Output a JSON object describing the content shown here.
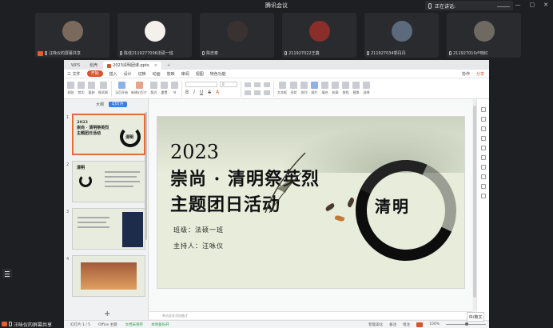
{
  "meeting": {
    "title": "腾讯会议",
    "speaking_label": "正在讲话:",
    "window_controls": [
      "—",
      "▢",
      "✕"
    ],
    "participants": [
      {
        "name": "汪咏仪的屏幕共享",
        "avatar_color": "#7a6a5e",
        "sharing": true
      },
      {
        "name": "陈佳2119277006法硕一班",
        "avatar_color": "#f4f0ec",
        "sharing": false
      },
      {
        "name": "陈忠泰",
        "avatar_color": "#3a3230",
        "sharing": false
      },
      {
        "name": "211927022王鑫",
        "avatar_color": "#8a2e2a",
        "sharing": false
      },
      {
        "name": "211927034郭丹丹",
        "avatar_color": "#5b6a7c",
        "sharing": false
      },
      {
        "name": "211927010卢琬红",
        "avatar_color": "#6e6a62",
        "sharing": false
      }
    ],
    "bottom_share_label": "汪咏仪的屏幕共享",
    "ime_label": "中/英文"
  },
  "wps": {
    "tabs": [
      {
        "label": "WPS",
        "active": false
      },
      {
        "label": "稻壳",
        "active": false
      },
      {
        "label": "2023清明团课.pptx",
        "active": true
      }
    ],
    "tab_add": "+",
    "menu": {
      "file": "三 文件",
      "items": [
        "开始",
        "插入",
        "设计",
        "切换",
        "动画",
        "放映",
        "审阅",
        "视图",
        "特色功能"
      ],
      "active_index": 0,
      "right": [
        "协作",
        "分享"
      ]
    },
    "ribbon": {
      "buttons": [
        "粘贴",
        "剪切",
        "复制",
        "格式刷",
        "当页开始",
        "新建幻灯片",
        "版式",
        "重置",
        "节"
      ],
      "font_field": "",
      "size_field": "0",
      "right_buttons": [
        "文本框",
        "形状",
        "排列",
        "图片",
        "填充",
        "轮廓",
        "查找",
        "替换",
        "选择"
      ]
    },
    "pane": {
      "tab_outline": "大纲",
      "tab_slides": "幻灯片",
      "thumbs": [
        {
          "num": "1",
          "text": "2023\n崇尚 · 清明祭英烈\n主题团日活动",
          "mark": "清明"
        },
        {
          "num": "2",
          "text": "清明",
          "mark": ""
        },
        {
          "num": "3",
          "text": "",
          "mark": ""
        },
        {
          "num": "4",
          "text": "",
          "mark": ""
        }
      ],
      "add_button": "+"
    },
    "slide": {
      "year": "2023",
      "title_line1": "崇尚 · 清明祭英烈",
      "title_line2": "主题团日活动",
      "class_line": "班级：法硕一班",
      "host_line": "主持人：汪咏仪",
      "center_mark": "清明"
    },
    "notes_placeholder": "单击此处添加备注",
    "status": {
      "slide_count": "幻灯片 1 / 5",
      "theme": "Office 主题",
      "backup": "文档未保存",
      "recovery": "本地备份开",
      "beautify": "智能美化",
      "notes": "备注",
      "comment": "批注",
      "zoom": "100%"
    }
  }
}
